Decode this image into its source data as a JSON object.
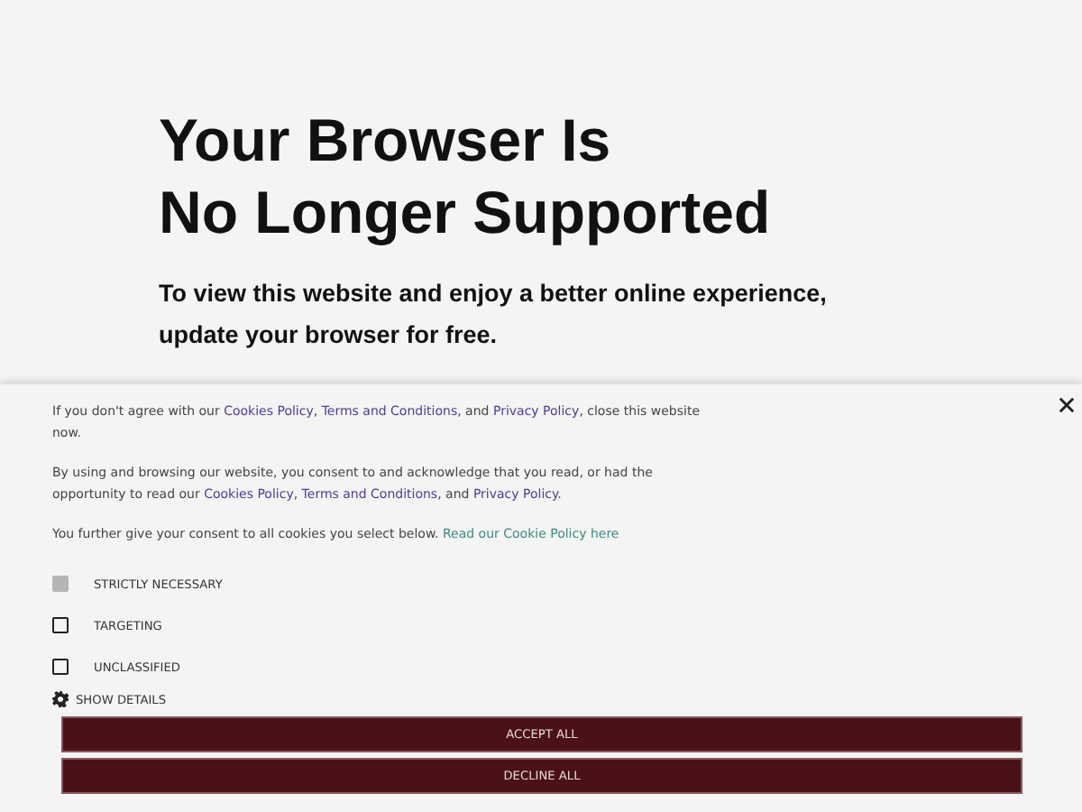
{
  "notice": {
    "title_lines": [
      "Your Browser Is",
      "No Longer Supported"
    ],
    "subtitle_lines": [
      "To view this website and enjoy a better online experience,",
      "update your browser for free."
    ]
  },
  "cookie_banner": {
    "paragraphs": [
      [
        {
          "kind": "text",
          "text": "If you don't agree with our "
        },
        {
          "kind": "link",
          "text": "Cookies Policy"
        },
        {
          "kind": "text",
          "text": ", "
        },
        {
          "kind": "link",
          "text": "Terms and Conditions"
        },
        {
          "kind": "text",
          "text": ", and "
        },
        {
          "kind": "link",
          "text": "Privacy Policy"
        },
        {
          "kind": "text",
          "text": ", close this website now."
        }
      ],
      [
        {
          "kind": "text",
          "text": "By using and browsing our website, you consent to and acknowledge that you read, or had the opportunity to read our "
        },
        {
          "kind": "link",
          "text": "Cookies Policy"
        },
        {
          "kind": "text",
          "text": ", "
        },
        {
          "kind": "link",
          "text": "Terms and Conditions"
        },
        {
          "kind": "text",
          "text": ", and "
        },
        {
          "kind": "link",
          "text": "Privacy Policy"
        },
        {
          "kind": "text",
          "text": "."
        }
      ],
      [
        {
          "kind": "text",
          "text": "You further give your consent to all cookies you select below. "
        },
        {
          "kind": "teal-link",
          "text": "Read our Cookie Policy here"
        }
      ]
    ],
    "options": [
      {
        "label": "STRICTLY NECESSARY",
        "checked": true,
        "disabled": true
      },
      {
        "label": "TARGETING",
        "checked": false,
        "disabled": false
      },
      {
        "label": "UNCLASSIFIED",
        "checked": false,
        "disabled": false
      }
    ],
    "details_label": "SHOW DETAILS",
    "buttons": [
      "ACCEPT ALL",
      "DECLINE ALL"
    ]
  }
}
